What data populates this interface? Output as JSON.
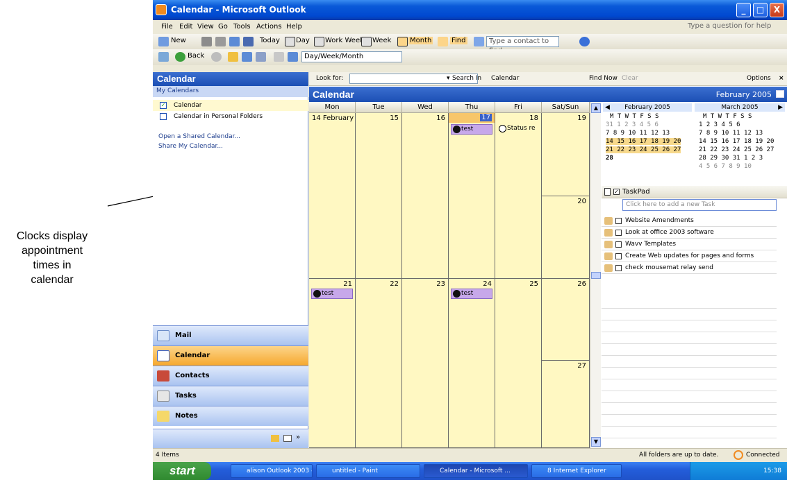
{
  "annotation": {
    "text_lines": [
      "Clocks display",
      "appointment",
      "times in",
      "calendar"
    ]
  },
  "window": {
    "title": "Calendar - Microsoft Outlook",
    "controls": {
      "minimize": "_",
      "maximize": "□",
      "close": "X"
    }
  },
  "menu": {
    "items": [
      "File",
      "Edit",
      "View",
      "Go",
      "Tools",
      "Actions",
      "Help"
    ],
    "help_placeholder": "Type a question for help"
  },
  "toolbar1": {
    "new_label": "New",
    "today_label": "Today",
    "day_label": "Day",
    "work_week_label": "Work Week",
    "week_label": "Week",
    "month_label": "Month",
    "find_label": "Find",
    "contact_placeholder": "Type a contact to find"
  },
  "toolbar2": {
    "back_label": "Back",
    "view_select": "Day/Week/Month"
  },
  "nav": {
    "header": "Calendar",
    "section": "My Calendars",
    "calendars": [
      {
        "label": "Calendar",
        "checked": true
      },
      {
        "label": "Calendar in Personal Folders",
        "checked": false
      }
    ],
    "links": [
      "Open a Shared Calendar...",
      "Share My Calendar..."
    ],
    "buttons": [
      "Mail",
      "Calendar",
      "Contacts",
      "Tasks",
      "Notes"
    ]
  },
  "findbar": {
    "look_for_label": "Look for:",
    "search_in_label": "Search In",
    "search_in_value": "Calendar",
    "find_now": "Find Now",
    "clear": "Clear",
    "options": "Options"
  },
  "calendar": {
    "title": "Calendar",
    "month_label": "February 2005",
    "day_headers": [
      "Mon",
      "Tue",
      "Wed",
      "Thu",
      "Fri",
      "Sat/Sun"
    ],
    "week1": {
      "mon": "14 February",
      "tue": "15",
      "wed": "16",
      "thu": "17",
      "fri": "18",
      "sat": "19",
      "sun": "20"
    },
    "week2": {
      "mon": "21",
      "tue": "22",
      "wed": "23",
      "thu": "24",
      "fri": "25",
      "sat": "26",
      "sun": "27"
    },
    "appointments": {
      "thu17": "test",
      "fri18": "Status re",
      "mon21": "test",
      "thu24": "test"
    }
  },
  "date_navigator": {
    "feb": {
      "title": "February 2005",
      "weekdays": "M T W T F S S",
      "rows": [
        "31  1  2  3  4  5  6",
        " 7  8  9 10 11 12 13",
        "14 15 16 17 18 19 20",
        "21 22 23 24 25 26 27",
        "28"
      ]
    },
    "mar": {
      "title": "March 2005",
      "weekdays": "M T W T F S S",
      "rows": [
        "    1  2  3  4  5  6",
        " 7  8  9 10 11 12 13",
        "14 15 16 17 18 19 20",
        "21 22 23 24 25 26 27",
        "28 29 30 31  1  2  3",
        " 4  5  6  7  8  9 10"
      ]
    }
  },
  "taskpad": {
    "title": "TaskPad",
    "new_task_placeholder": "Click here to add a new Task",
    "tasks": [
      "Website Amendments",
      "Look at office 2003 software",
      "Wavv Templates",
      "Create Web updates for pages and forms",
      "check mousemat relay send"
    ]
  },
  "status": {
    "items": "4 Items",
    "sync": "All folders are up to date.",
    "connection": "Connected"
  },
  "taskbar": {
    "start": "start",
    "tasks": [
      "alison Outlook 2003 - ...",
      "untitled - Paint",
      "Calendar - Microsoft ...",
      "8 Internet Explorer"
    ],
    "clock": "15:38"
  }
}
